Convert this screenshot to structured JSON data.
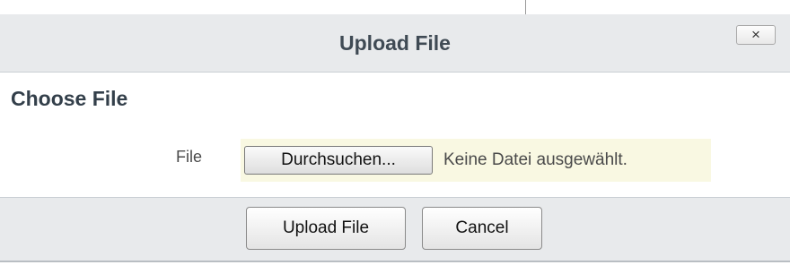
{
  "dialog": {
    "title": "Upload File",
    "close_label": "×"
  },
  "section": {
    "heading": "Choose File"
  },
  "file_field": {
    "label": "File",
    "browse_label": "Durchsuchen...",
    "status_text": "Keine Datei ausgewählt."
  },
  "footer": {
    "upload_label": "Upload File",
    "cancel_label": "Cancel"
  },
  "colors": {
    "header_bg": "#e8eaec",
    "file_widget_bg": "#f9f8e2",
    "title_text": "#3f4a54"
  }
}
